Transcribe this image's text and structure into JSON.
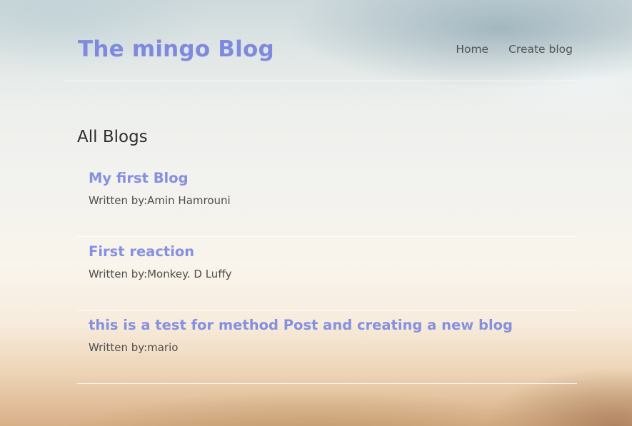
{
  "navbar": {
    "brand": "The mingo Blog",
    "links": [
      {
        "label": "Home"
      },
      {
        "label": "Create blog"
      }
    ]
  },
  "main": {
    "heading": "All Blogs",
    "blogs": [
      {
        "title": "My first Blog",
        "author_line": "Written by:Amin Hamrouni"
      },
      {
        "title": "First reaction",
        "author_line": "Written by:Monkey. D Luffy"
      },
      {
        "title": "this is a test for method Post and creating a new blog",
        "author_line": "Written by:mario"
      }
    ]
  },
  "colors": {
    "accent": "#7f8ade",
    "text": "#2e2e2e",
    "muted": "#555555"
  }
}
